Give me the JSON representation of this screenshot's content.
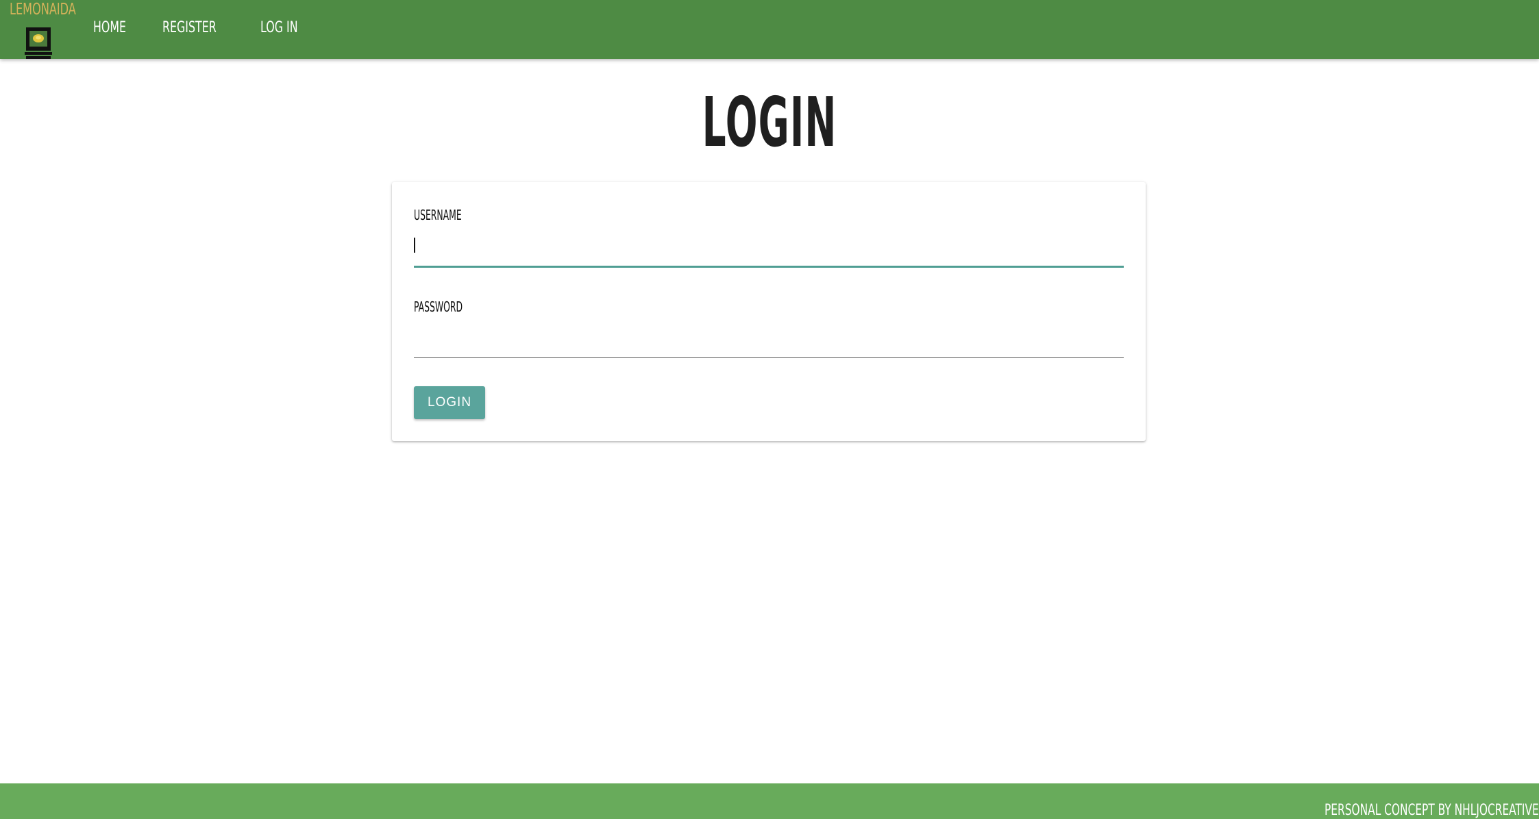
{
  "brand": {
    "name": "LEMONAIDA",
    "logo_icon": "lemon-tv-icon"
  },
  "nav": {
    "items": [
      {
        "label": "HOME"
      },
      {
        "label": "REGISTER"
      },
      {
        "label": "LOG IN"
      }
    ]
  },
  "page": {
    "title": "LOGIN"
  },
  "form": {
    "username_label": "USERNAME",
    "username_value": "",
    "password_label": "PASSWORD",
    "password_value": "",
    "submit_label": "LOGIN"
  },
  "footer": {
    "text": "PERSONAL CONCEPT BY NHLJOCREATIVE"
  },
  "colors": {
    "nav_bg": "#4e8b44",
    "footer_bg": "#68ab5b",
    "accent": "#5aa49c",
    "brand_text": "#d4b25a"
  }
}
